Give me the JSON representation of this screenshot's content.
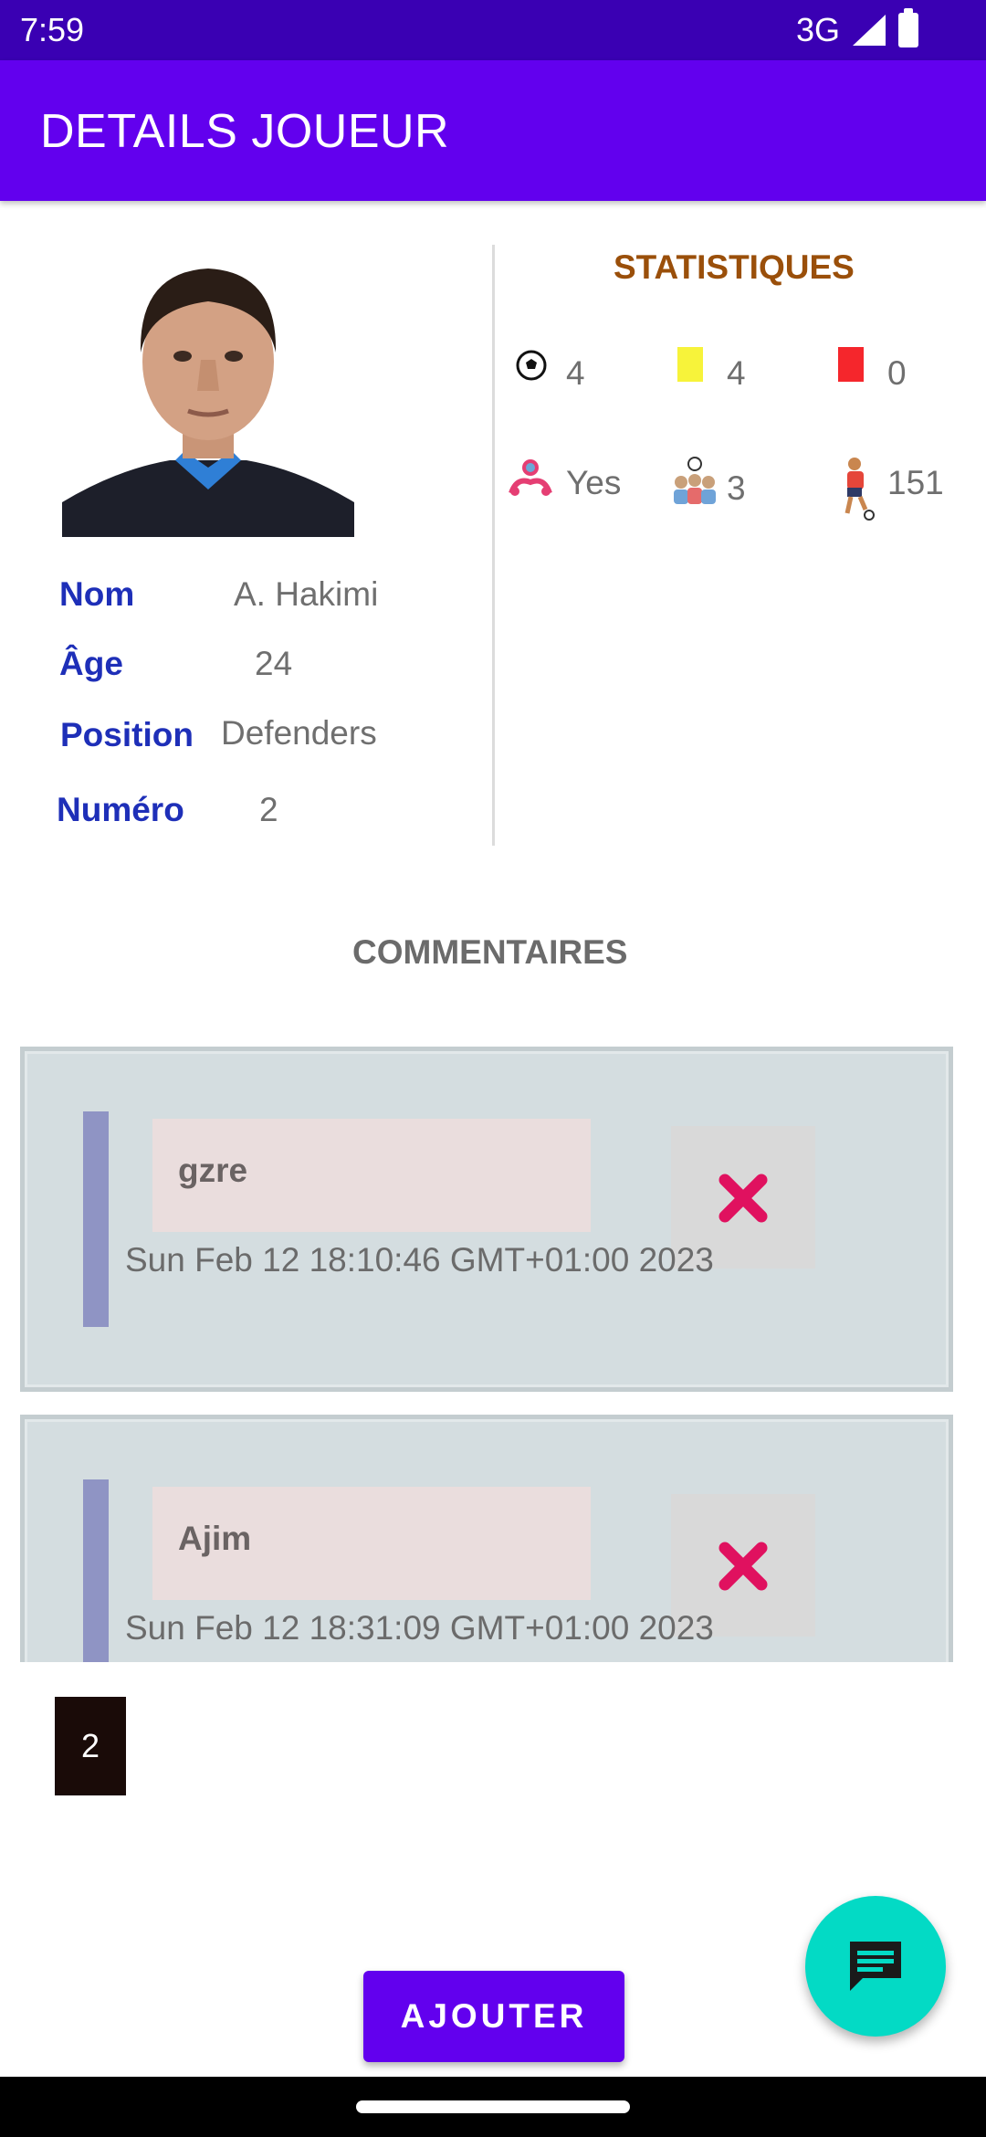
{
  "status_bar": {
    "time": "7:59",
    "network": "3G"
  },
  "app_bar": {
    "title": "DETAILS JOUEUR"
  },
  "player": {
    "nom_label": "Nom",
    "nom_value": "A. Hakimi",
    "age_label": "Âge",
    "age_value": "24",
    "position_label": "Position",
    "position_value": "Defenders",
    "numero_label": "Numéro",
    "numero_value": "2"
  },
  "stats": {
    "title": "STATISTIQUES",
    "goals": "4",
    "yellow_cards": "4",
    "red_cards": "0",
    "captain": "Yes",
    "assists": "3",
    "appearances": "151"
  },
  "comments": {
    "title": "COMMENTAIRES",
    "items": [
      {
        "author": "gzre",
        "date": "Sun Feb 12 18:10:46 GMT+01:00 2023"
      },
      {
        "author": "Ajim",
        "date": "Sun Feb 12 18:31:09 GMT+01:00 2023"
      }
    ],
    "count": "2"
  },
  "actions": {
    "add_label": "AJOUTER"
  },
  "colors": {
    "primary": "#6200ee",
    "status": "#3a00b3",
    "accent": "#03dac5",
    "label": "#1e2fb8",
    "stats_title": "#9a4f0a",
    "delete": "#e0115f"
  },
  "icons": {
    "goals": "soccer-ball-icon",
    "yellow": "yellow-card-icon",
    "red": "red-card-icon",
    "captain": "captain-icon",
    "assists": "assists-icon",
    "appearances": "player-icon",
    "delete": "close-icon",
    "fab": "comment-icon"
  }
}
